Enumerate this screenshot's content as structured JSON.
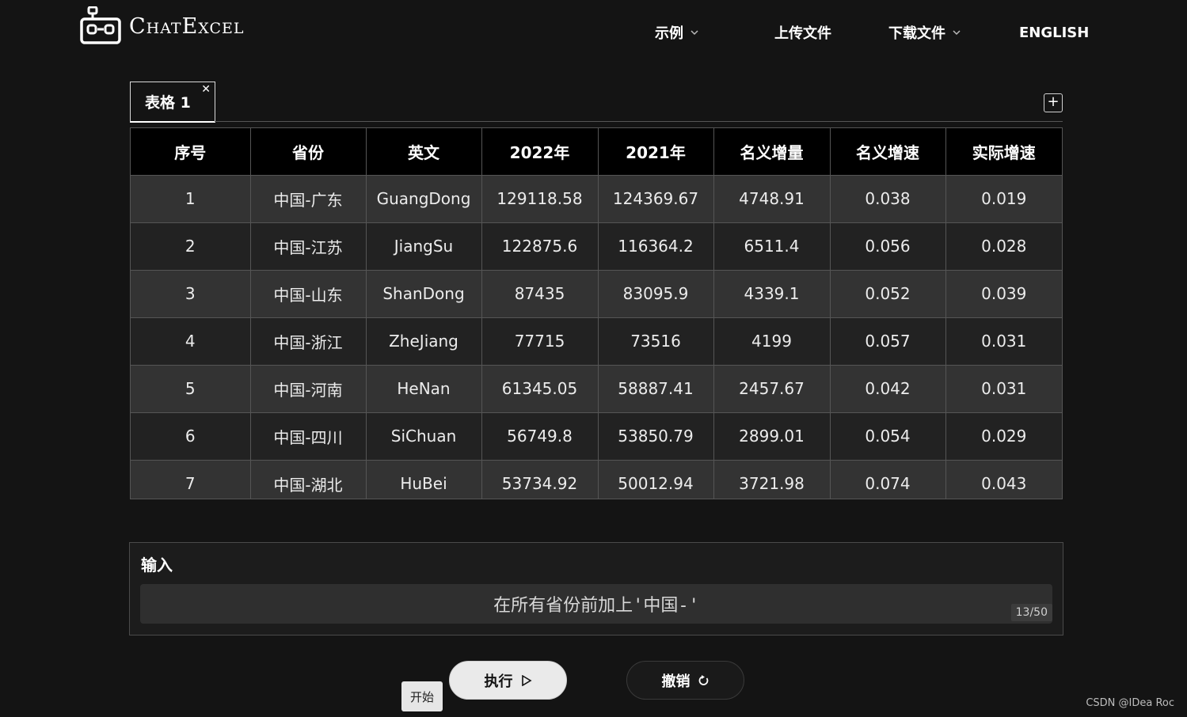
{
  "header": {
    "logo_text": "ChatExcel",
    "nav": [
      {
        "label": "示例",
        "has_dropdown": true
      },
      {
        "label": "上传文件",
        "has_dropdown": false
      },
      {
        "label": "下载文件",
        "has_dropdown": true
      },
      {
        "label": "ENGLISH",
        "has_dropdown": false
      }
    ]
  },
  "tabs": [
    {
      "label": "表格 1",
      "close_icon": "close-icon",
      "active": true
    }
  ],
  "tab_add_symbol": "+",
  "table": {
    "columns": [
      "序号",
      "省份",
      "英文",
      "2022年",
      "2021年",
      "名义增量",
      "名义增速",
      "实际增速"
    ],
    "rows": [
      [
        "1",
        "中国-广东",
        "GuangDong",
        "129118.58",
        "124369.67",
        "4748.91",
        "0.038",
        "0.019"
      ],
      [
        "2",
        "中国-江苏",
        "JiangSu",
        "122875.6",
        "116364.2",
        "6511.4",
        "0.056",
        "0.028"
      ],
      [
        "3",
        "中国-山东",
        "ShanDong",
        "87435",
        "83095.9",
        "4339.1",
        "0.052",
        "0.039"
      ],
      [
        "4",
        "中国-浙江",
        "ZheJiang",
        "77715",
        "73516",
        "4199",
        "0.057",
        "0.031"
      ],
      [
        "5",
        "中国-河南",
        "HeNan",
        "61345.05",
        "58887.41",
        "2457.67",
        "0.042",
        "0.031"
      ],
      [
        "6",
        "中国-四川",
        "SiChuan",
        "56749.8",
        "53850.79",
        "2899.01",
        "0.054",
        "0.029"
      ],
      [
        "7",
        "中国-湖北",
        "HuBei",
        "53734.92",
        "50012.94",
        "3721.98",
        "0.074",
        "0.043"
      ]
    ]
  },
  "input": {
    "label": "输入",
    "value": "在所有省份前加上'中国-'",
    "counter": "13/50"
  },
  "actions": {
    "run_label": "执行",
    "run_icon": "play-icon",
    "undo_label": "撤销",
    "undo_icon": "undo-icon",
    "tooltip": "开始"
  },
  "watermark": "CSDN @IDea Roc",
  "colors": {
    "background": "#141414",
    "header_row": "#000000",
    "row_odd": "#333333",
    "row_even": "#222222",
    "run_button": "#eaeaea"
  }
}
